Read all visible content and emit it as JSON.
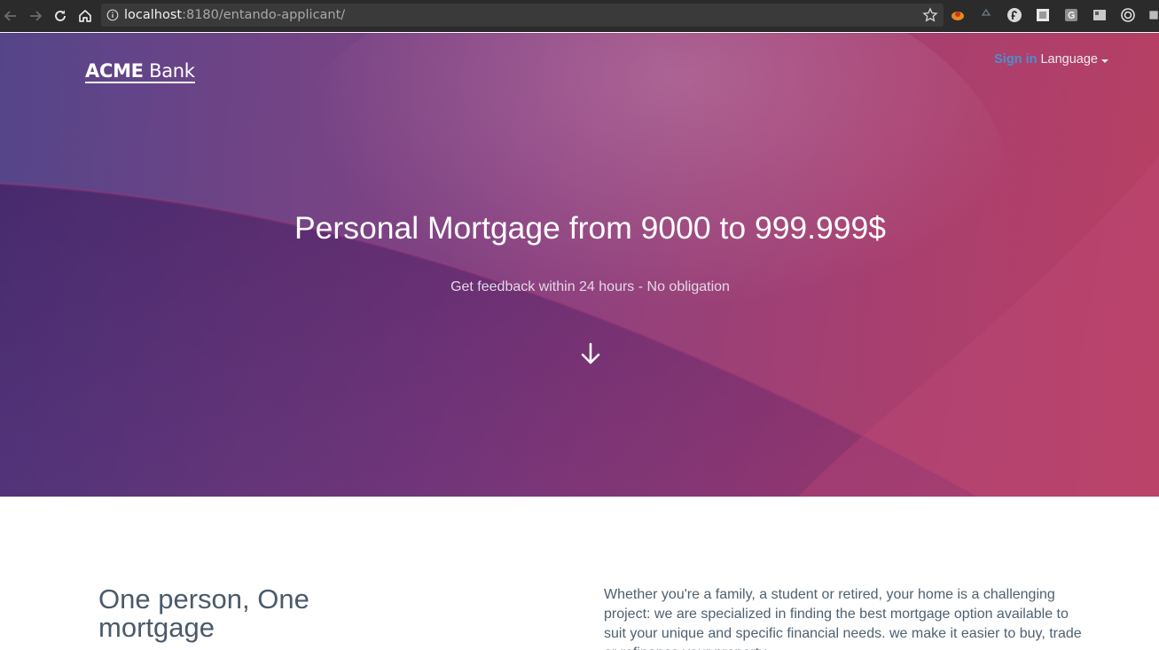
{
  "browser": {
    "url_host": "localhost",
    "url_path": ":8180/entando-applicant/"
  },
  "header": {
    "logo_bold": "ACME",
    "logo_thin": "Bank",
    "signin_label": "Sign in",
    "language_label": "Language"
  },
  "hero": {
    "title": "Personal Mortgage from 9000 to 999.999$",
    "subtitle": "Get feedback within 24 hours - No obligation"
  },
  "content": {
    "title": "One person, One mortgage",
    "body": "Whether you're a family, a student or retired, your home is a challenging project: we are specialized in finding the best mortgage option available to suit your unique and specific financial needs. we make it easier to buy, trade or refinance your property."
  },
  "colors": {
    "browser_bg": "#2b2b2b",
    "hero_purple": "#5b3f86",
    "hero_magenta": "#a2386a",
    "signin_blue": "#4d8fcf",
    "content_text": "#4e6171"
  }
}
